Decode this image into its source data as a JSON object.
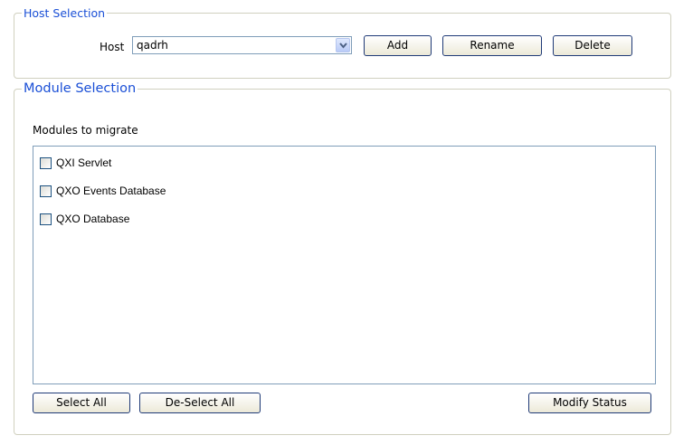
{
  "host_selection": {
    "legend": "Host Selection",
    "host_label": "Host",
    "host_value": "qadrh",
    "add_label": "Add",
    "rename_label": "Rename",
    "delete_label": "Delete"
  },
  "module_selection": {
    "legend": "Module Selection",
    "modules_label": "Modules to migrate",
    "items": [
      {
        "label": "QXI Servlet",
        "checked": false
      },
      {
        "label": "QXO Events Database",
        "checked": false
      },
      {
        "label": "QXO Database",
        "checked": false
      }
    ],
    "select_all_label": "Select All",
    "deselect_all_label": "De-Select All",
    "modify_status_label": "Modify Status"
  },
  "icons": {
    "dropdown": "chevron-down-icon",
    "checkbox": "checkbox-unchecked"
  },
  "colors": {
    "legend": "#1a4fd6",
    "border": "#d0d0bf",
    "button_border": "#1f3a77",
    "input_border": "#7f9db9"
  }
}
